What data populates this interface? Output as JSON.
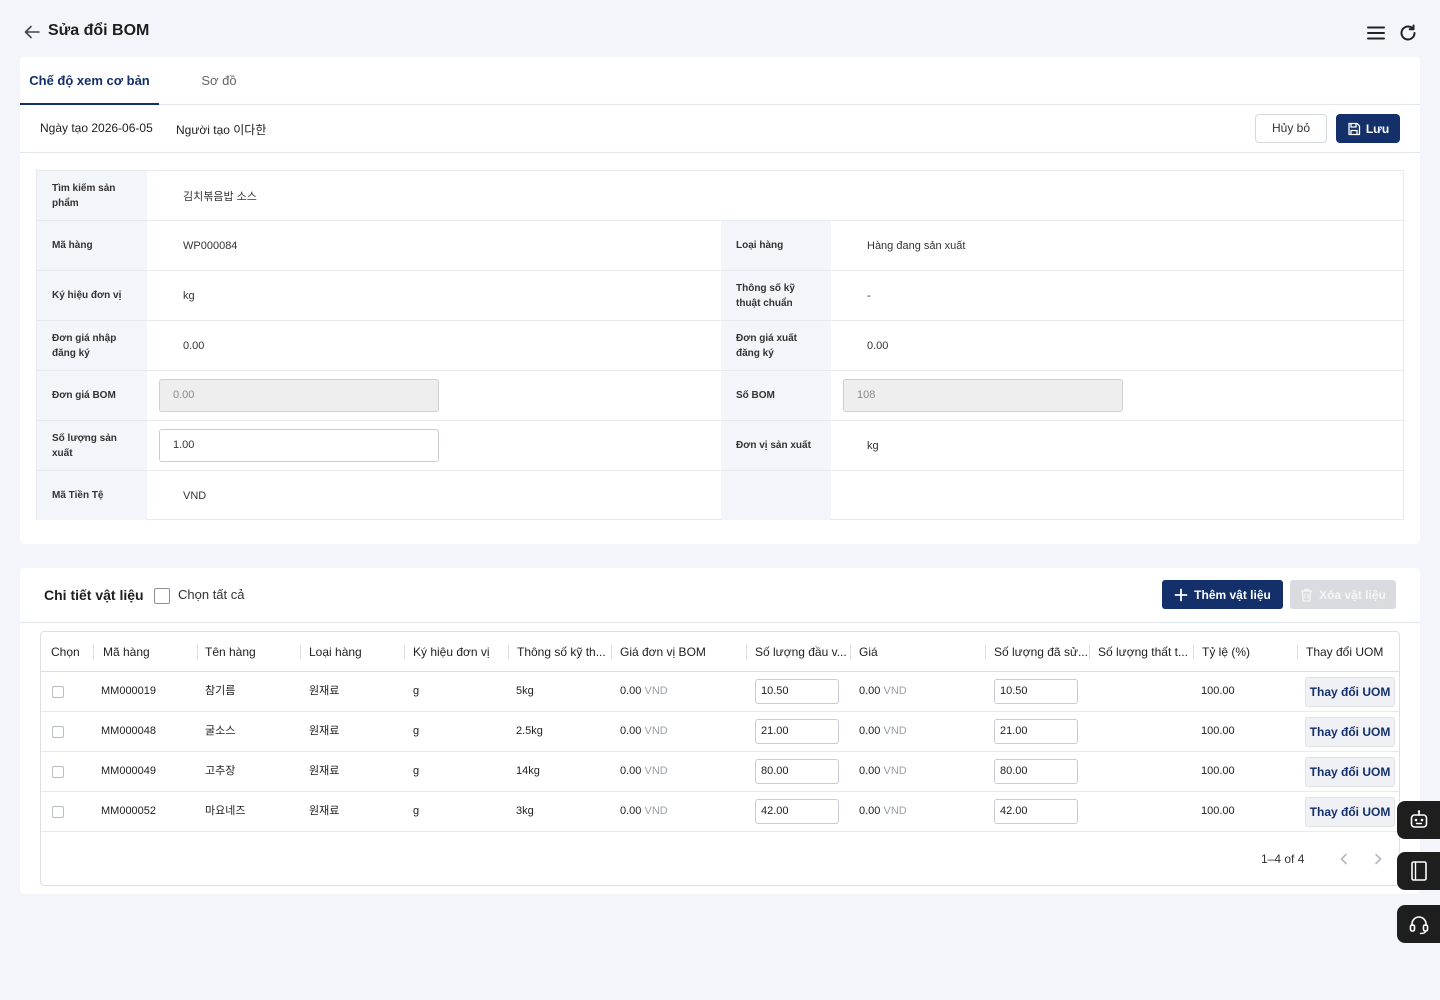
{
  "header": {
    "title": "Sửa đổi BOM"
  },
  "tabs": [
    {
      "label": "Chế độ xem cơ bản",
      "active": true
    },
    {
      "label": "Sơ đồ",
      "active": false
    }
  ],
  "meta": {
    "created_date": "Ngày tạo 2026-06-05",
    "creator": "Người tạo 이다한"
  },
  "actions": {
    "cancel_label": "Hủy bỏ",
    "save_label": "Lưu"
  },
  "form": {
    "search_label": "Tìm kiếm sản phẩm",
    "search_value": "김치볶음밥 소스",
    "item_code_label": "Mã hàng",
    "item_code_value": "WP000084",
    "item_type_label": "Loại hàng",
    "item_type_value": "Hàng đang sản xuất",
    "uom_label": "Ký hiệu đơn vị",
    "uom_value": "kg",
    "spec_label": "Thông số kỹ thuật chuẩn",
    "spec_value": "-",
    "purchase_price_label": "Đơn giá nhập đăng ký",
    "purchase_price_value": "0.00",
    "sales_price_label": "Đơn giá xuất đăng ký",
    "sales_price_value": "0.00",
    "bom_price_label": "Đơn giá BOM",
    "bom_price_value": "0.00",
    "bom_number_label": "Số BOM",
    "bom_number_value": "108",
    "production_qty_label": "Số lượng sản xuất",
    "production_qty_value": "1.00",
    "production_unit_label": "Đơn vị sản xuất",
    "production_unit_value": "kg",
    "currency_label": "Mã Tiền Tệ",
    "currency_value": "VND"
  },
  "materials": {
    "title": "Chi tiết vật liệu",
    "select_all_label": "Chọn tất cả",
    "add_label": "Thêm vật liệu",
    "delete_label": "Xóa vật liệu",
    "columns": [
      "Chọn",
      "Mã hàng",
      "Tên hàng",
      "Loại hàng",
      "Ký hiệu đơn vị",
      "Thông số kỹ th...",
      "Giá đơn vị BOM",
      "Số lượng đầu v...",
      "Giá",
      "Số lượng đã sử...",
      "Số lượng thất t...",
      "Tỷ lệ (%)",
      "Thay đổi UOM"
    ],
    "rows": [
      {
        "code": "MM000019",
        "name": "참기름",
        "type": "원재료",
        "unit": "g",
        "spec": "5kg",
        "bom_price": "0.00",
        "currency": "VND",
        "input_qty": "10.50",
        "price": "0.00",
        "used_qty": "10.50",
        "loss_qty": "",
        "ratio": "100.00",
        "uom_label": "Thay đổi UOM"
      },
      {
        "code": "MM000048",
        "name": "굴소스",
        "type": "원재료",
        "unit": "g",
        "spec": "2.5kg",
        "bom_price": "0.00",
        "currency": "VND",
        "input_qty": "21.00",
        "price": "0.00",
        "used_qty": "21.00",
        "loss_qty": "",
        "ratio": "100.00",
        "uom_label": "Thay đổi UOM"
      },
      {
        "code": "MM000049",
        "name": "고추장",
        "type": "원재료",
        "unit": "g",
        "spec": "14kg",
        "bom_price": "0.00",
        "currency": "VND",
        "input_qty": "80.00",
        "price": "0.00",
        "used_qty": "80.00",
        "loss_qty": "",
        "ratio": "100.00",
        "uom_label": "Thay đổi UOM"
      },
      {
        "code": "MM000052",
        "name": "마요네즈",
        "type": "원재료",
        "unit": "g",
        "spec": "3kg",
        "bom_price": "0.00",
        "currency": "VND",
        "input_qty": "42.00",
        "price": "0.00",
        "used_qty": "42.00",
        "loss_qty": "",
        "ratio": "100.00",
        "uom_label": "Thay đổi UOM"
      }
    ],
    "pagination": "1–4 of 4"
  },
  "side_tools": [
    "robot-icon",
    "notebook-icon",
    "headset-icon"
  ],
  "colors": {
    "primary": "#13306b",
    "page_bg": "#f3f5fa",
    "label_bg": "#f2f5fa"
  }
}
